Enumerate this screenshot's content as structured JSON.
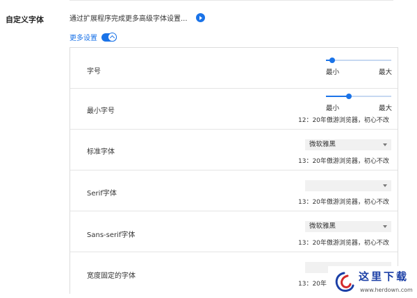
{
  "section": {
    "label": "自定义字体"
  },
  "extension": {
    "text": "通过扩展程序完成更多高级字体设置..."
  },
  "more_settings": {
    "label": "更多设置"
  },
  "font_size": {
    "label": "字号",
    "slider_value": 0.1,
    "min_label": "最小",
    "max_label": "最大"
  },
  "min_font_size": {
    "label": "最小字号",
    "slider_value": 0.35,
    "min_label": "最小",
    "max_label": "最大",
    "hint": "12：20年傲游浏览器，初心不改"
  },
  "standard_font": {
    "label": "标准字体",
    "selected": "微软雅黑",
    "hint": "13：20年傲游浏览器，初心不改"
  },
  "serif_font": {
    "label": "Serif字体",
    "selected": "",
    "hint": "13：20年傲游浏览器，初心不改"
  },
  "sans_serif_font": {
    "label": "Sans-serif字体",
    "selected": "微软雅黑",
    "hint": "13：20年傲游浏览器，初心不改"
  },
  "fixed_width_font": {
    "label": "宽度固定的字体",
    "selected": "",
    "hint": "13：20年"
  },
  "watermark": {
    "title": "这里下载",
    "url": "www.herdown.com"
  },
  "colors": {
    "accent": "#1a73e8",
    "watermark_blue": "#1b3fa6",
    "watermark_red": "#d42a2a"
  },
  "icons": {
    "extension": "play-circle-icon",
    "toggle_arrow": "chevron-up-icon",
    "select_arrow": "caret-down-icon"
  }
}
